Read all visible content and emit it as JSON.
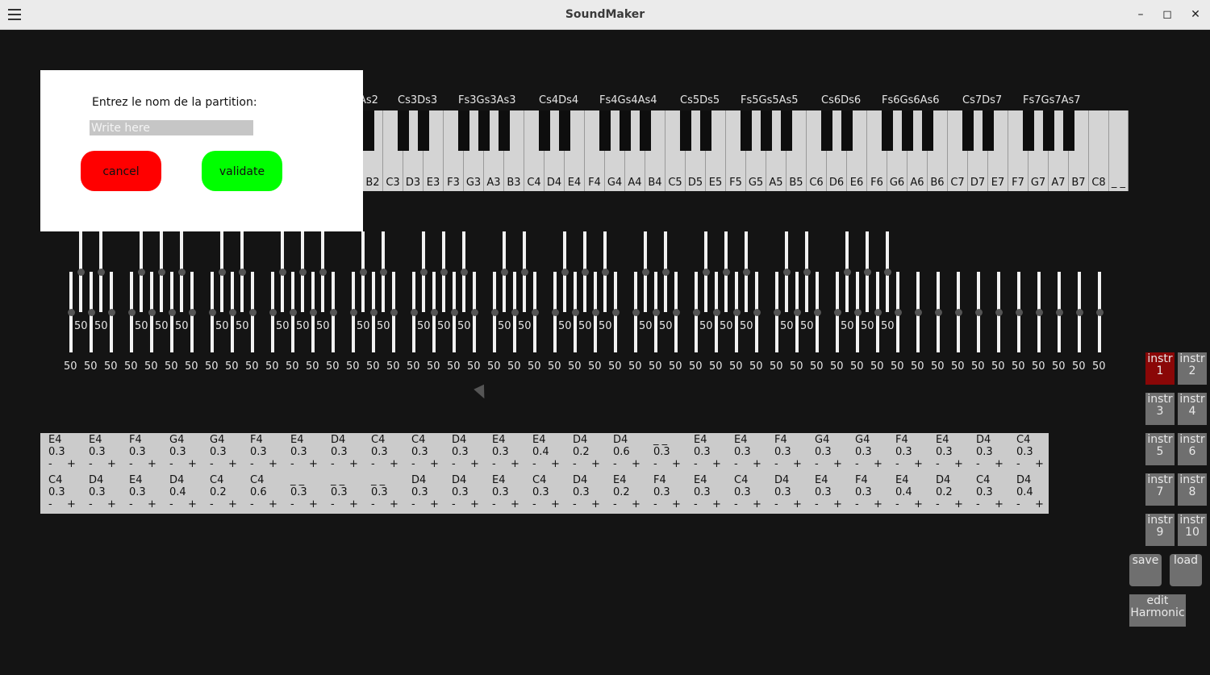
{
  "window": {
    "title": "SoundMaker",
    "menu_icon": "hamburger-icon",
    "minimize_glyph": "–",
    "maximize_glyph": "◻",
    "close_glyph": "✕"
  },
  "colors": {
    "background": "#141414",
    "active_instrument": "#8a0707",
    "cancel": "#ff0000",
    "validate": "#00ff00"
  },
  "dialog": {
    "prompt": "Entrez le nom de la partition:",
    "input_placeholder": "Write here",
    "input_value": "",
    "cancel_label": "cancel",
    "validate_label": "validate"
  },
  "black_key_labels": [
    "As2",
    "Cs3Ds3",
    "Fs3Gs3As3",
    "Cs4Ds4",
    "Fs4Gs4As4",
    "Cs5Ds5",
    "Fs5Gs5As5",
    "Cs6Ds6",
    "Fs6Gs6As6",
    "Cs7Ds7",
    "Fs7Gs7As7"
  ],
  "white_key_labels": [
    "B2",
    "C3",
    "D3",
    "E3",
    "F3",
    "G3",
    "A3",
    "B3",
    "C4",
    "D4",
    "E4",
    "F4",
    "G4",
    "A4",
    "B4",
    "C5",
    "D5",
    "E5",
    "F5",
    "G5",
    "A5",
    "B5",
    "C6",
    "D6",
    "E6",
    "F6",
    "G6",
    "A6",
    "B6",
    "C7",
    "D7",
    "E7",
    "F7",
    "G7",
    "A7",
    "B7",
    "C8",
    "_ _"
  ],
  "slider_default_value": "50",
  "sequence": [
    [
      {
        "note": "E4",
        "dur": "0.3"
      },
      {
        "note": "E4",
        "dur": "0.3"
      },
      {
        "note": "F4",
        "dur": "0.3"
      },
      {
        "note": "G4",
        "dur": "0.3"
      },
      {
        "note": "G4",
        "dur": "0.3"
      },
      {
        "note": "F4",
        "dur": "0.3"
      },
      {
        "note": "E4",
        "dur": "0.3"
      },
      {
        "note": "D4",
        "dur": "0.3"
      },
      {
        "note": "C4",
        "dur": "0.3"
      },
      {
        "note": "C4",
        "dur": "0.3"
      },
      {
        "note": "D4",
        "dur": "0.3"
      },
      {
        "note": "E4",
        "dur": "0.3"
      },
      {
        "note": "E4",
        "dur": "0.4"
      },
      {
        "note": "D4",
        "dur": "0.2"
      },
      {
        "note": "D4",
        "dur": "0.6"
      },
      {
        "note": "_ _",
        "dur": "0.3"
      },
      {
        "note": "E4",
        "dur": "0.3"
      },
      {
        "note": "E4",
        "dur": "0.3"
      },
      {
        "note": "F4",
        "dur": "0.3"
      },
      {
        "note": "G4",
        "dur": "0.3"
      },
      {
        "note": "G4",
        "dur": "0.3"
      },
      {
        "note": "F4",
        "dur": "0.3"
      },
      {
        "note": "E4",
        "dur": "0.3"
      },
      {
        "note": "D4",
        "dur": "0.3"
      },
      {
        "note": "C4",
        "dur": "0.3"
      }
    ],
    [
      {
        "note": "C4",
        "dur": "0.3"
      },
      {
        "note": "D4",
        "dur": "0.3"
      },
      {
        "note": "E4",
        "dur": "0.3"
      },
      {
        "note": "D4",
        "dur": "0.4"
      },
      {
        "note": "C4",
        "dur": "0.2"
      },
      {
        "note": "C4",
        "dur": "0.6"
      },
      {
        "note": "_ _",
        "dur": "0.3"
      },
      {
        "note": "_ _",
        "dur": "0.3"
      },
      {
        "note": "_ _",
        "dur": "0.3"
      },
      {
        "note": "D4",
        "dur": "0.3"
      },
      {
        "note": "D4",
        "dur": "0.3"
      },
      {
        "note": "E4",
        "dur": "0.3"
      },
      {
        "note": "C4",
        "dur": "0.3"
      },
      {
        "note": "D4",
        "dur": "0.3"
      },
      {
        "note": "E4",
        "dur": "0.2"
      },
      {
        "note": "F4",
        "dur": "0.3"
      },
      {
        "note": "E4",
        "dur": "0.3"
      },
      {
        "note": "C4",
        "dur": "0.3"
      },
      {
        "note": "D4",
        "dur": "0.3"
      },
      {
        "note": "E4",
        "dur": "0.3"
      },
      {
        "note": "F4",
        "dur": "0.3"
      },
      {
        "note": "E4",
        "dur": "0.4"
      },
      {
        "note": "D4",
        "dur": "0.2"
      },
      {
        "note": "C4",
        "dur": "0.3"
      },
      {
        "note": "D4",
        "dur": "0.4"
      }
    ]
  ],
  "sequence_minus": "-",
  "sequence_plus": "+",
  "instruments": [
    {
      "l1": "instr",
      "l2": "1",
      "active": true
    },
    {
      "l1": "instr",
      "l2": "2",
      "active": false
    },
    {
      "l1": "instr",
      "l2": "3",
      "active": false
    },
    {
      "l1": "instr",
      "l2": "4",
      "active": false
    },
    {
      "l1": "instr",
      "l2": "5",
      "active": false
    },
    {
      "l1": "instr",
      "l2": "6",
      "active": false
    },
    {
      "l1": "instr",
      "l2": "7",
      "active": false
    },
    {
      "l1": "instr",
      "l2": "8",
      "active": false
    },
    {
      "l1": "instr",
      "l2": "9",
      "active": false
    },
    {
      "l1": "instr",
      "l2": "10",
      "active": false
    }
  ],
  "save_label": "save",
  "load_label": "load",
  "edit_harmonic_line1": "edit",
  "edit_harmonic_line2": "Harmonic"
}
